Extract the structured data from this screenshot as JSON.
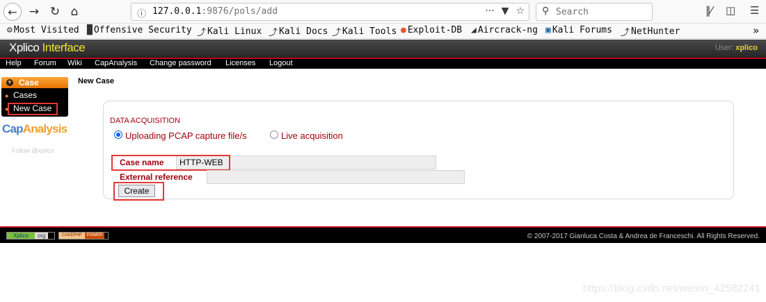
{
  "browser": {
    "url_host": "127.0.0.1",
    "url_path": ":9876/pols/add",
    "search_placeholder": "Search",
    "bookmarks": [
      {
        "label": "Most Visited",
        "icon": "gear-icon"
      },
      {
        "label": "Offensive Security",
        "icon": "offsec-icon"
      },
      {
        "label": "Kali Linux",
        "icon": "kali-dragon-icon"
      },
      {
        "label": "Kali Docs",
        "icon": "kali-dragon-icon"
      },
      {
        "label": "Kali Tools",
        "icon": "kali-dragon-icon"
      },
      {
        "label": "Exploit-DB",
        "icon": "exploitdb-icon"
      },
      {
        "label": "Aircrack-ng",
        "icon": "aircrack-icon"
      },
      {
        "label": "Kali Forums",
        "icon": "kali-forums-icon"
      },
      {
        "label": "NetHunter",
        "icon": "kali-dragon-icon"
      }
    ]
  },
  "app": {
    "logo_prefix": "Xplico",
    "logo_suffix": "Interface",
    "user_label": "User:",
    "user_name": "xplico",
    "menu": [
      "Help",
      "Forum",
      "Wiki",
      "CapAnalysis",
      "Change password",
      "Licenses",
      "Logout"
    ]
  },
  "sidebar": {
    "header": "Case",
    "items": [
      "Cases",
      "New Case"
    ],
    "cap_logo_a": "Cap",
    "cap_logo_b": "Analysis",
    "follow": "Follow @xplico"
  },
  "main": {
    "title": "New Case",
    "section": "DATA ACQUISITION",
    "radio_upload": "Uploading PCAP capture file/s",
    "radio_live": "Live acquisition",
    "selected_mode": "upload",
    "case_name_label": "Case name",
    "case_name_value": "HTTP-WEB",
    "external_ref_label": "External reference",
    "external_ref_value": "",
    "create_label": "Create"
  },
  "footer": {
    "badge_xplico_a": "Xplico",
    "badge_xplico_b": "org",
    "badge_cake_a": "CAKEPHP",
    "badge_cake_b": "POWER",
    "copyright": "© 2007-2017 Gianluca Costa & Andrea de Franceschi. All Rights Reserved."
  },
  "watermark": "https://blog.csdn.net/weixin_42582241",
  "colors": {
    "accent_red": "#a0000e",
    "highlight_frame": "#e53935",
    "logo_yellow": "#f5e12a",
    "case_orange": "#ffa53a"
  }
}
